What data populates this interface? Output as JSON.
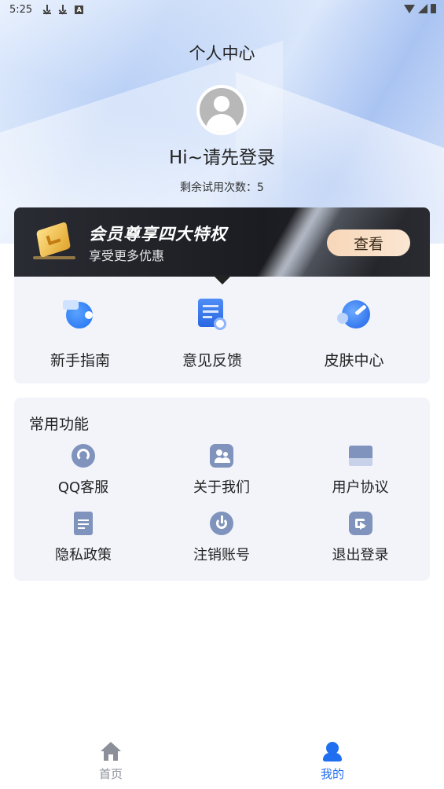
{
  "status_bar": {
    "time": "5:25"
  },
  "header": {
    "title": "个人中心",
    "greeting": "Hi~请先登录",
    "trial_text": "剩余试用次数：5"
  },
  "vip": {
    "title": "会员尊享四大特权",
    "subtitle": "享受更多优惠",
    "button": "查看"
  },
  "features": [
    {
      "label": "新手指南",
      "icon": "guide-icon"
    },
    {
      "label": "意见反馈",
      "icon": "feedback-icon"
    },
    {
      "label": "皮肤中心",
      "icon": "skin-icon"
    }
  ],
  "common": {
    "title": "常用功能",
    "items": [
      {
        "label": "QQ客服",
        "icon": "headset-icon"
      },
      {
        "label": "关于我们",
        "icon": "people-icon"
      },
      {
        "label": "用户协议",
        "icon": "agreement-icon"
      },
      {
        "label": "隐私政策",
        "icon": "document-icon"
      },
      {
        "label": "注销账号",
        "icon": "power-icon"
      },
      {
        "label": "退出登录",
        "icon": "logout-icon"
      }
    ]
  },
  "tabbar": {
    "items": [
      {
        "label": "首页",
        "icon": "home-icon",
        "active": false
      },
      {
        "label": "我的",
        "icon": "user-icon",
        "active": true
      }
    ],
    "active_color": "#1f6ff0",
    "inactive_color": "#8a8f99"
  }
}
